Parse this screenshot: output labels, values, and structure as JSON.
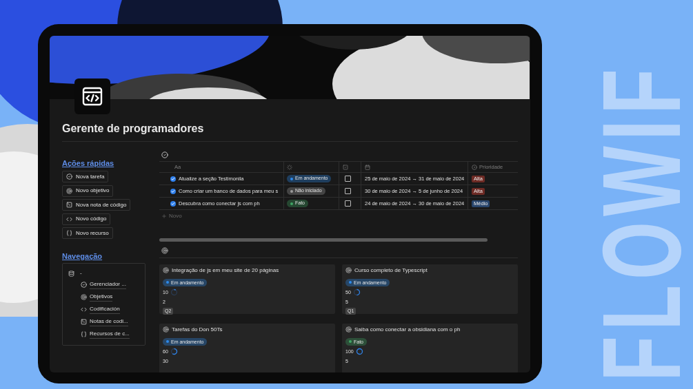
{
  "brand": "FLOWIF",
  "page": {
    "title": "Gerente de programadores"
  },
  "quick_actions": {
    "title": "Ações rápidas",
    "items": [
      {
        "kind": "task",
        "label": "Nova tarefa"
      },
      {
        "kind": "goal",
        "label": "Novo objetivo"
      },
      {
        "kind": "note",
        "label": "Nova nota de código"
      },
      {
        "kind": "code",
        "label": "Novo código"
      },
      {
        "kind": "resource",
        "label": "Novo recurso"
      }
    ]
  },
  "navigation": {
    "title": "Navegação",
    "root_label": "-",
    "items": [
      {
        "kind": "task",
        "label": "Gerenciador ..."
      },
      {
        "kind": "goal",
        "label": "Objetivos"
      },
      {
        "kind": "code",
        "label": "Codificación"
      },
      {
        "kind": "note",
        "label": "Notas de codi..."
      },
      {
        "kind": "resource",
        "label": "Recursos de c..."
      }
    ]
  },
  "tasks": {
    "name_header": "Aa",
    "priority_header": "Prioridade",
    "new_label": "Novo",
    "rows": [
      {
        "name": "Atualize a seção Testimonila",
        "status": {
          "label": "Em andamento",
          "color": "#2e8aea"
        },
        "done": false,
        "dates": "25 de maio de 2024 → 31 de maio de 2024",
        "priority": {
          "label": "Alta",
          "color": "#6e2b25"
        }
      },
      {
        "name": "Como criar um banco de dados para meu s",
        "status": {
          "label": "Não iniciado",
          "color": "#9b9b9b"
        },
        "done": false,
        "dates": "30 de maio de 2024 → 5 de junho de 2024",
        "priority": {
          "label": "Alta",
          "color": "#6e2b25"
        }
      },
      {
        "name": "Descubra como conectar js com ph",
        "status": {
          "label": "Fato",
          "color": "#3fa564"
        },
        "done": false,
        "dates": "24 de maio de 2024 → 30 de maio de 2024",
        "priority": {
          "label": "Médio",
          "color": "#28456c"
        }
      }
    ]
  },
  "goals": [
    {
      "title": "Integração de js em meu site de 20 páginas",
      "status": {
        "label": "Em andamento",
        "color": "#2e8aea"
      },
      "progress": "10",
      "count": "2",
      "tag": "Q2"
    },
    {
      "title": "Curso completo de Typescript",
      "status": {
        "label": "Em andamento",
        "color": "#2e8aea"
      },
      "progress": "50",
      "count": "5",
      "tag": "Q1"
    },
    {
      "title": "Tarefas do Don 50Ts",
      "status": {
        "label": "Em andamento",
        "color": "#2e8aea"
      },
      "progress": "60",
      "count": "30"
    },
    {
      "title": "Saiba como conectar a obsidiana com o ph",
      "status": {
        "label": "Fato",
        "color": "#3fa564"
      },
      "progress": "100",
      "count": "5"
    }
  ]
}
